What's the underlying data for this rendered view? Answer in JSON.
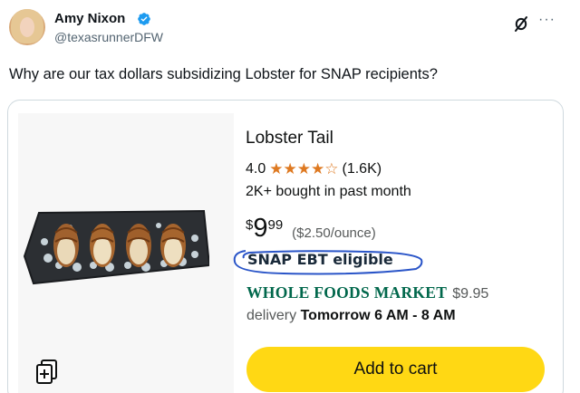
{
  "author": {
    "name": "Amy Nixon",
    "handle": "@texasrunnerDFW"
  },
  "header_icons": [
    "verified-badge-icon",
    "slash-circle-icon",
    "more-icon"
  ],
  "more_label": "···",
  "tweet": {
    "text": "Why are our tax dollars subsidizing Lobster for SNAP recipients?"
  },
  "product": {
    "title": "Lobster Tail",
    "rating": "4.0",
    "stars_filled": 4,
    "stars_total": 5,
    "rating_count": "(1.6K)",
    "bought": "2K+ bought in past month",
    "price_symbol": "$",
    "price_whole": "9",
    "price_fraction": "99",
    "unit_price": "($2.50/ounce)",
    "snap_label": "SNAP EBT eligible",
    "seller": "WHOLE FOODS MARKET",
    "seller_price": "$9.95",
    "delivery_prefix": "delivery",
    "delivery_time": "Tomorrow 6 AM - 8 AM",
    "add_to_cart": "Add to cart"
  },
  "colors": {
    "star": "#de7921",
    "add_to_cart_bg": "#ffd814",
    "seller_green": "#00674b",
    "annotation_blue": "#2a55c8",
    "verified_blue": "#1d9bf0"
  }
}
